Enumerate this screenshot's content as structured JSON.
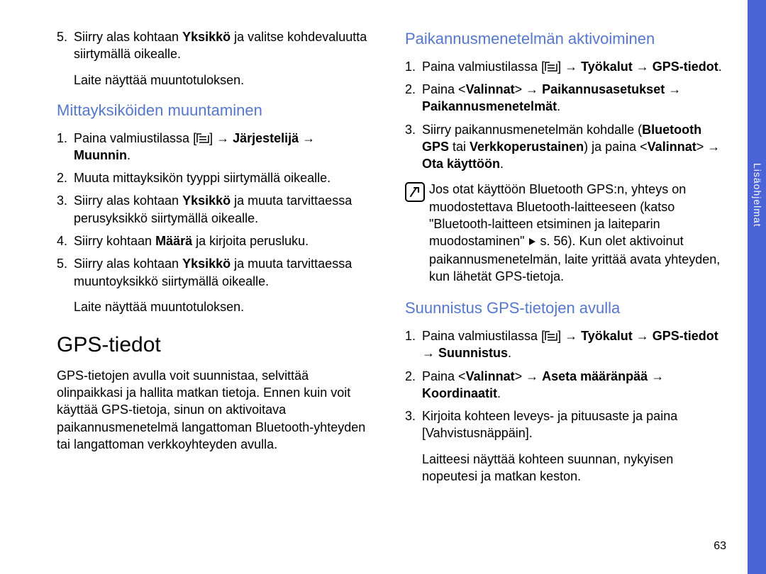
{
  "side_label": "Lisäohjelmat",
  "page_number": "63",
  "left": {
    "step5_a": "Siirry alas kohtaan ",
    "step5_b": "Yksikkö",
    "step5_c": " ja valitse kohdevaluutta siirtymällä oikealle.",
    "step5_result": "Laite näyttää muuntotuloksen.",
    "h_units": "Mittayksiköiden muuntaminen",
    "u1_a": "Paina valmiustilassa [",
    "u1_b": "] → ",
    "u1_c": "Järjestelijä",
    "u1_d": " → ",
    "u1_e": "Muunnin",
    "u1_f": ".",
    "u2": "Muuta mittayksikön tyyppi siirtymällä oikealle.",
    "u3_a": "Siirry alas kohtaan ",
    "u3_b": "Yksikkö",
    "u3_c": " ja muuta tarvittaessa perusyksikkö siirtymällä oikealle.",
    "u4_a": "Siirry kohtaan ",
    "u4_b": "Määrä",
    "u4_c": " ja kirjoita perusluku.",
    "u5_a": "Siirry alas kohtaan ",
    "u5_b": "Yksikkö",
    "u5_c": " ja muuta tarvittaessa muuntoyksikkö siirtymällä oikealle.",
    "u5_result": "Laite näyttää muuntotuloksen.",
    "h_gps": "GPS-tiedot",
    "gps_intro": "GPS-tietojen avulla voit suunnistaa, selvittää olinpaikkasi ja hallita matkan tietoja. Ennen kuin voit käyttää GPS-tietoja, sinun on aktivoitava paikannusmenetelmä langattoman Bluetooth-yhteyden tai langattoman verkkoyhteyden avulla."
  },
  "right": {
    "h_paik": "Paikannusmenetelmän aktivoiminen",
    "p1_a": "Paina valmiustilassa [",
    "p1_b": "] → ",
    "p1_c": "Työkalut",
    "p1_d": " → ",
    "p1_e": "GPS-tiedot",
    "p1_f": ".",
    "p2_a": "Paina <",
    "p2_b": "Valinnat",
    "p2_c": "> → ",
    "p2_d": "Paikannusasetukset",
    "p2_e": " → ",
    "p2_f": "Paikannusmenetelmät",
    "p2_g": ".",
    "p3_a": "Siirry paikannusmenetelmän kohdalle (",
    "p3_b": "Bluetooth GPS",
    "p3_c": " tai ",
    "p3_d": "Verkkoperustainen",
    "p3_e": ") ja paina <",
    "p3_f": "Valinnat",
    "p3_g": "> → ",
    "p3_h": "Ota käyttöön",
    "p3_i": ".",
    "note_a": "Jos otat käyttöön Bluetooth GPS:n, yhteys on muodostettava Bluetooth-laitteeseen (katso \"Bluetooth-laitteen etsiminen ja laiteparin muodostaminen\" ",
    "note_b": " s. 56). Kun olet aktivoinut paikannusmenetelmän, laite yrittää avata yhteyden, kun lähetät GPS-tietoja.",
    "h_suun": "Suunnistus GPS-tietojen avulla",
    "s1_a": "Paina valmiustilassa [",
    "s1_b": "] → ",
    "s1_c": "Työkalut",
    "s1_d": " → ",
    "s1_e": "GPS-tiedot",
    "s1_f": " → ",
    "s1_g": "Suunnistus",
    "s1_h": ".",
    "s2_a": "Paina <",
    "s2_b": "Valinnat",
    "s2_c": "> → ",
    "s2_d": "Aseta määränpää",
    "s2_e": " → ",
    "s2_f": "Koordinaatit",
    "s2_g": ".",
    "s3": "Kirjoita kohteen leveys- ja pituusaste ja paina [Vahvistusnäppäin].",
    "s3_result": "Laitteesi näyttää kohteen suunnan, nykyisen nopeutesi ja matkan keston."
  }
}
